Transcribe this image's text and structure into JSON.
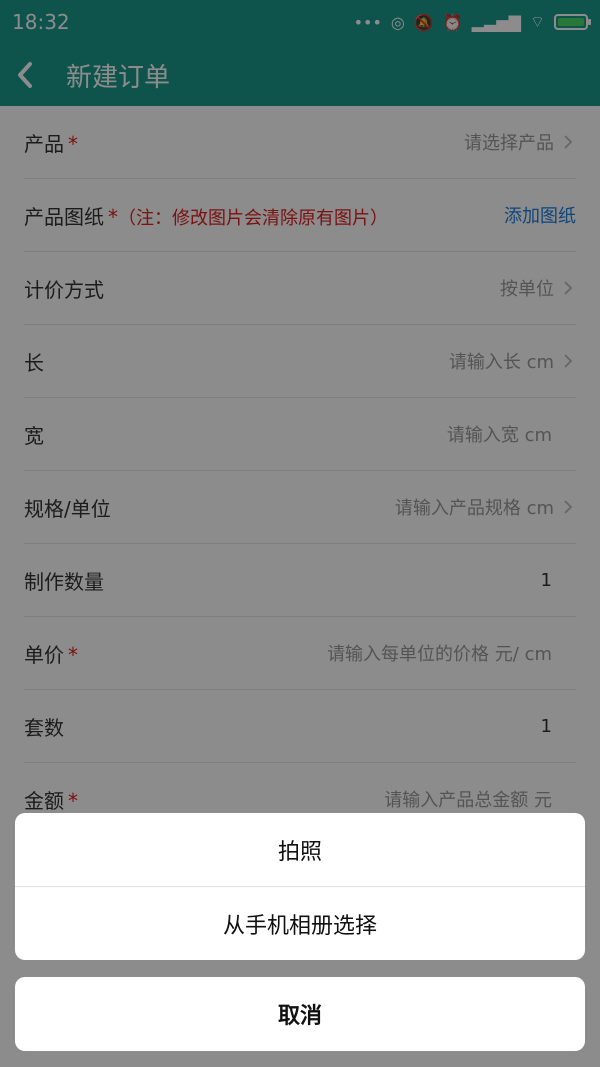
{
  "statusbar": {
    "time": "18:32"
  },
  "header": {
    "title": "新建订单"
  },
  "form": {
    "rows": [
      {
        "label": "产品",
        "required": "*",
        "right": "请选择产品"
      },
      {
        "label": "产品图纸",
        "required": "*",
        "note": "（注：修改图片会清除原有图片）",
        "right": "添加图纸"
      },
      {
        "label": "计价方式",
        "right": "按单位"
      },
      {
        "label": "长",
        "right": "请输入长 cm"
      },
      {
        "label": "宽",
        "right": "请输入宽 cm"
      },
      {
        "label": "规格/单位",
        "right": "请输入产品规格 cm"
      },
      {
        "label": "制作数量",
        "value": "1"
      },
      {
        "label": "单价",
        "required": "*",
        "right": "请输入每单位的价格 元/ cm"
      },
      {
        "label": "套数",
        "value": "1"
      },
      {
        "label": "金额",
        "required": "*",
        "right": "请输入产品总金额 元"
      }
    ]
  },
  "action_sheet": {
    "options": [
      "拍照",
      "从手机相册选择"
    ],
    "cancel": "取消"
  },
  "colors": {
    "primary": "#1a9a8d",
    "required": "#e02020",
    "link": "#1d7fe0"
  }
}
